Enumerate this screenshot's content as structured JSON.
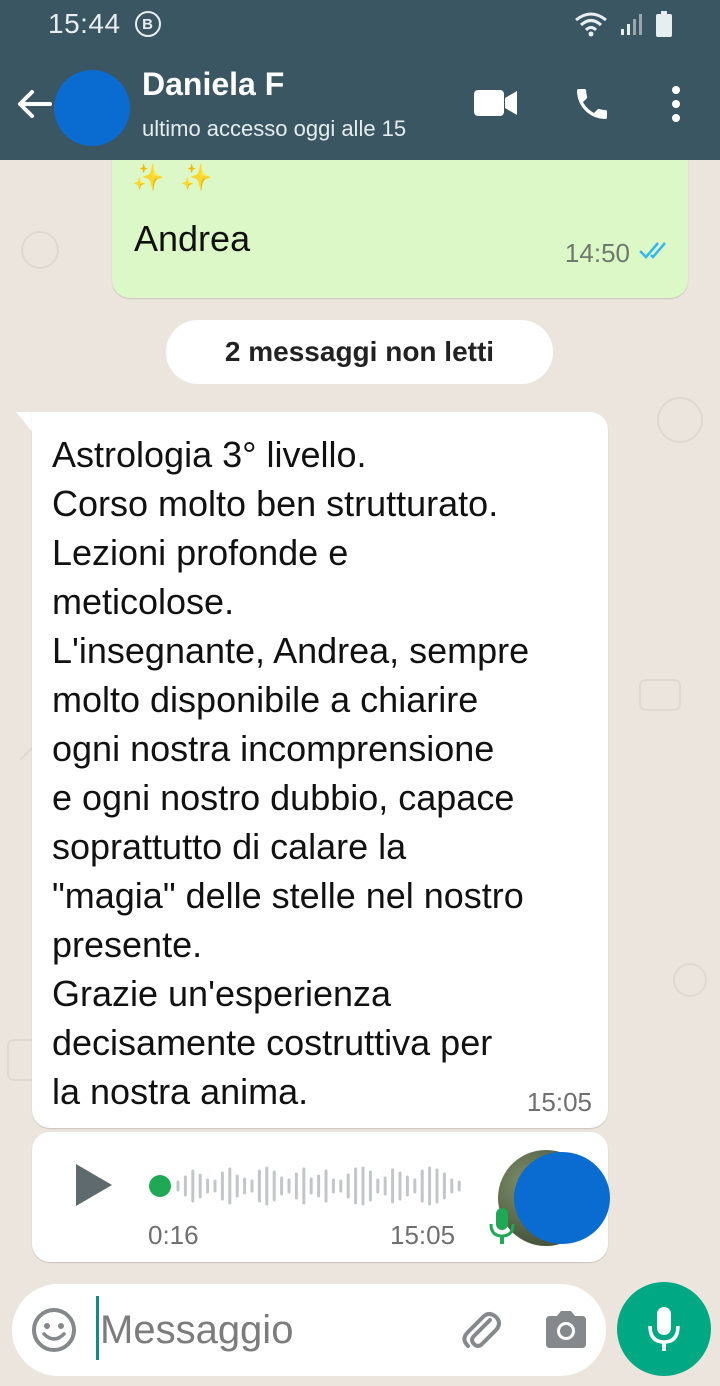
{
  "status_bar": {
    "time": "15:44",
    "badge": "B",
    "icons": [
      "wifi-icon",
      "signal-icon",
      "battery-icon"
    ]
  },
  "header": {
    "contact_name": "Daniela F",
    "contact_status": "ultimo accesso oggi alle 15",
    "icons": [
      "back-arrow-icon",
      "video-call-icon",
      "phone-icon",
      "more-vert-icon"
    ],
    "bar_color": "#3a5662"
  },
  "chat": {
    "outgoing_message": {
      "emojis": "✨✨",
      "text": "Andrea",
      "time": "14:50",
      "status": "read",
      "bubble_color": "#dcf8c6",
      "tick_color": "#34b7f1"
    },
    "unread_banner": "2 messaggi non letti",
    "incoming_message": {
      "lines": [
        "Astrologia 3° livello.",
        "Corso molto ben strutturato.",
        "Lezioni profonde e",
        "meticolose.",
        "L'insegnante, Andrea, sempre",
        "molto disponibile a chiarire",
        "ogni nostra incomprensione",
        "e ogni nostro dubbio, capace",
        "soprattutto di calare la",
        "\"magia\" delle stelle nel nostro",
        "presente.",
        "Grazie un'esperienza",
        "decisamente costruttiva per",
        "la nostra anima."
      ],
      "time": "15:05"
    },
    "voice_message": {
      "duration": "0:16",
      "time": "15:05",
      "played": false,
      "accent_color": "#1fa855"
    }
  },
  "composer": {
    "placeholder": "Messaggio",
    "value": "",
    "icons": [
      "emoji-icon",
      "attach-icon",
      "camera-icon",
      "mic-icon"
    ],
    "mic_button_color": "#00a884"
  }
}
